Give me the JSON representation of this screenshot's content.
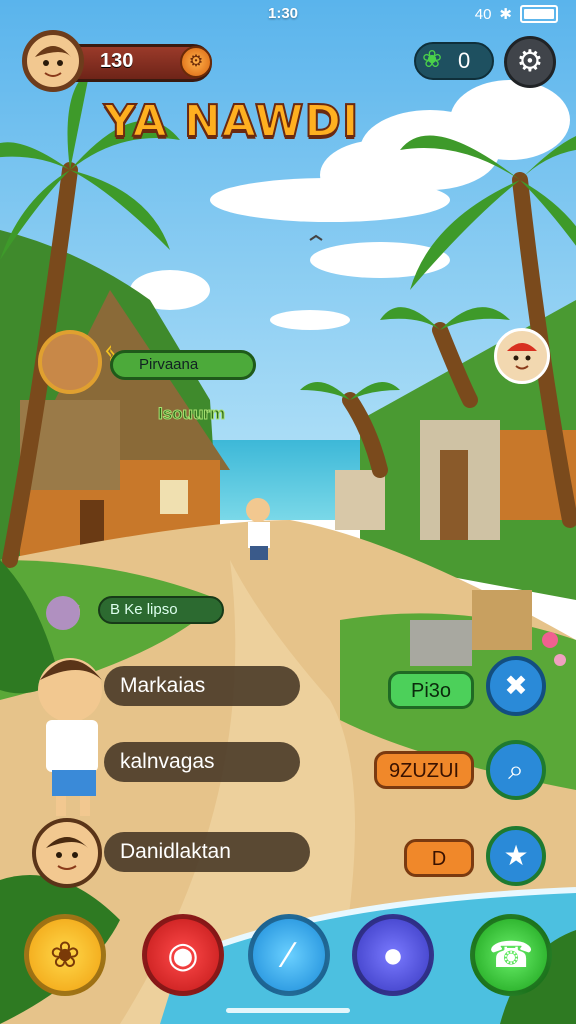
{
  "status_bar": {
    "time": "1:30",
    "right_text": "40",
    "icons": [
      "signal-icon",
      "bluetooth-icon",
      "battery-icon"
    ]
  },
  "hud": {
    "coins": "130",
    "gems": "0",
    "title": "YA NAWDI"
  },
  "scene_labels": {
    "quest_top": "Pirvaana",
    "quest_top_icon": "ᛃ",
    "house_sign": "Isouurm",
    "quest_mid": "Ke lipso",
    "quest_mid_icon": "B"
  },
  "menu": {
    "items": [
      {
        "label": "Markaias"
      },
      {
        "label": "kalnvagas"
      },
      {
        "label": "Danidlaktan"
      }
    ]
  },
  "right_panel": {
    "pills": [
      "Pi3o",
      "9ZUZUI",
      "D"
    ],
    "buttons": [
      "crossed-tools-icon",
      "search-icon",
      "star-icon"
    ]
  },
  "dock": [
    "bone-icon",
    "camera-icon",
    "edit-icon",
    "chat-icon",
    "phone-icon"
  ],
  "colors": {
    "sky": "#6ec3f0",
    "sea": "#35b8d8",
    "sand": "#e8c890",
    "grass": "#5aa838",
    "title": "#ffb020"
  }
}
